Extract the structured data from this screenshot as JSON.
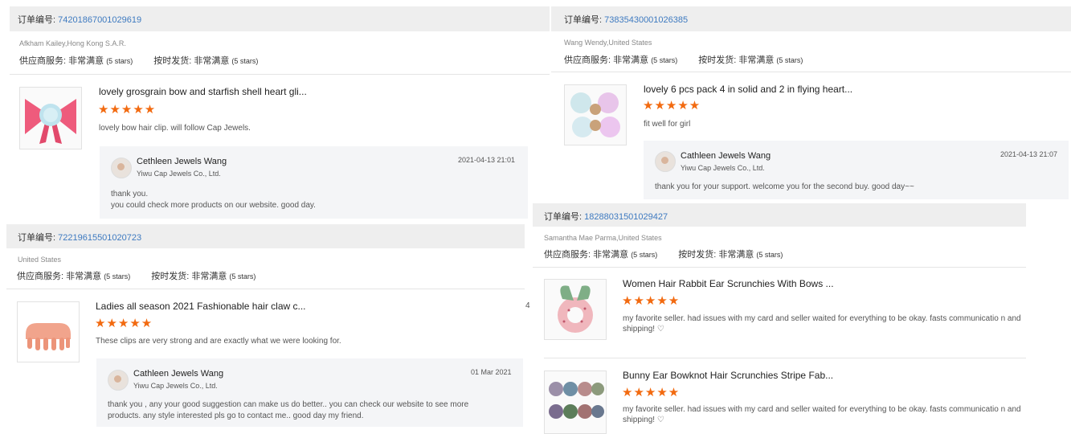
{
  "labels": {
    "order_prefix": "订单编号: ",
    "supplier_service": "供应商服务: ",
    "on_time_shipping": "按时发货: ",
    "very_satisfied": "非常满意",
    "five_stars": "(5 stars)",
    "stars": "★★★★★"
  },
  "colors": {
    "accent_orange": "#f26a10",
    "link_blue": "#3e7ac0",
    "bar_gray": "#eeeeee"
  },
  "cards": [
    {
      "order_number": "74201867001029619",
      "buyer": "Afkham Kailey,Hong Kong S.A.R.",
      "items": [
        {
          "title": "lovely grosgrain bow and starfish shell heart gli...",
          "rating": 5,
          "review": "lovely bow hair clip. will follow Cap Jewels."
        }
      ],
      "reply": {
        "name": "Cethleen Jewels Wang",
        "company": "Yiwu Cap Jewels Co., Ltd.",
        "date": "2021-04-13 21:01",
        "text": "thank you.\nyou could check more products on our website. good day."
      }
    },
    {
      "order_number": "73835430001026385",
      "buyer": "Wang Wendy,United States",
      "items": [
        {
          "title": "lovely 6 pcs pack 4 in solid and 2 in flying heart...",
          "rating": 5,
          "review": "fit well for girl"
        }
      ],
      "reply": {
        "name": "Cathleen Jewels Wang",
        "company": "Yiwu Cap Jewels Co., Ltd.",
        "date": "2021-04-13 21:07",
        "text": "thank you for your support. welcome you for the second buy. good day~~"
      }
    },
    {
      "order_number": "72219615501020723",
      "buyer": "United States",
      "items": [
        {
          "title": "Ladies all season 2021 Fashionable hair claw c...",
          "rating": 5,
          "review": "These clips are very strong and are exactly what we were looking for."
        }
      ],
      "reply": {
        "name": "Cathleen Jewels Wang",
        "company": "Yiwu Cap Jewels Co., Ltd.",
        "date": "01 Mar 2021",
        "text": "thank you , any your good suggestion can make us do better.. you can check our website to see more products. any style interested pls go to contact me.. good day my friend."
      }
    },
    {
      "order_number": "18288031501029427",
      "buyer": "Samantha Mae Parma,United States",
      "items": [
        {
          "title": "Women Hair Rabbit Ear Scrunchies With Bows ...",
          "rating": 5,
          "review": "my favorite seller. had issues with my card and seller waited for everything to be okay. fasts communicatio n and shipping! ♡"
        },
        {
          "title": "Bunny Ear Bowknot Hair Scrunchies Stripe Fab...",
          "rating": 5,
          "review": "my favorite seller. had issues with my card and seller waited for everything to be okay. fasts communicatio n and shipping! ♡"
        }
      ]
    }
  ],
  "stray_glyph": "4"
}
